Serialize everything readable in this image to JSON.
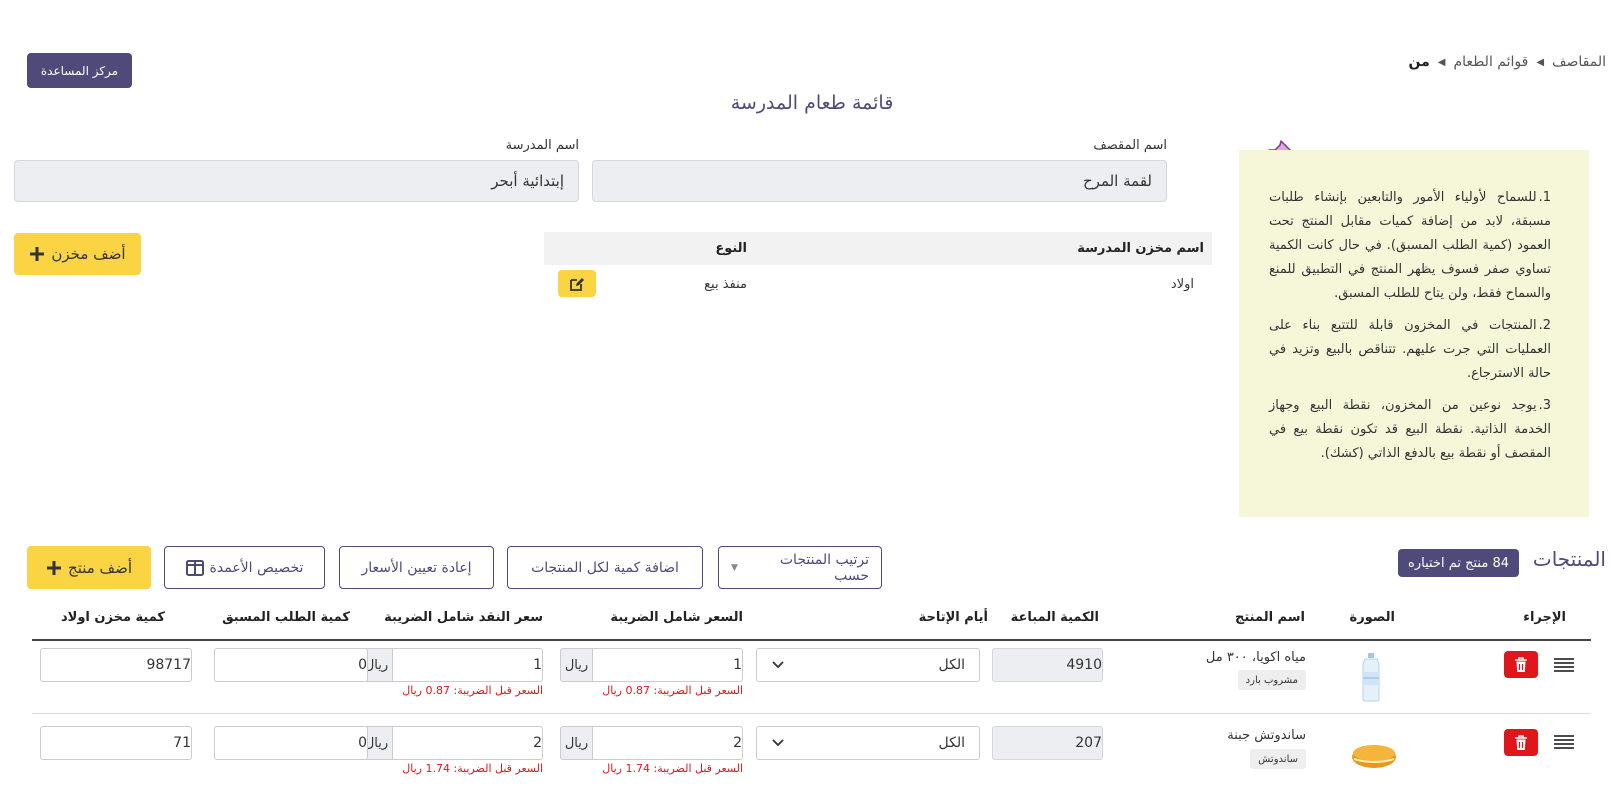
{
  "breadcrumb": {
    "items": [
      "المقاصف",
      "قوائم الطعام"
    ],
    "current": "من"
  },
  "help_button": "مركز المساعدة",
  "page_title": "قائمة طعام المدرسة",
  "notes": [
    {
      "num": "1.",
      "text": "للسماح لأولياء الأمور والتابعين بإنشاء طلبات مسبقة، لابد من إضافة كميات مقابل المنتج تحت العمود (كمية الطلب المسبق). في حال كانت الكمية تساوي صفر فسوف يظهر المنتج في التطبيق للمنع والسماح فقط، ولن يتاح للطلب المسبق."
    },
    {
      "num": "2.",
      "text": "المنتجات في المخزون قابلة للتتبع بناء على العمليات التي جرت عليهم. تتناقص بالبيع وتزيد في حالة الاسترجاع."
    },
    {
      "num": "3.",
      "text": "يوجد نوعين من المخزون، نقطة البيع وجهاز الخدمة الذاتية. نقطة البيع قد تكون نقطة بيع في المقصف أو نقطة بيع بالدفع الذاتي (كشك)."
    }
  ],
  "form": {
    "canteen_label": "اسم المقصف",
    "canteen_value": "لقمة المرح",
    "school_label": "اسم المدرسة",
    "school_value": "إبتدائية أبحر"
  },
  "warehouses": {
    "headers": {
      "name": "اسم مخزن المدرسة",
      "type": "النوع"
    },
    "rows": [
      {
        "name": "اولاد",
        "type": "منفذ بيع"
      }
    ],
    "add_label": "أضف مخزن"
  },
  "products": {
    "title": "المنتجات",
    "selected_badge": "84 منتج تم اختياره",
    "sort_label": "ترتيب المنتجات حسب",
    "add_qty_label": "اضافة كمية لكل المنتجات",
    "reset_prices_label": "إعادة تعيين الأسعار",
    "columns_label": "تخصيص الأعمدة",
    "add_label": "أضف منتج",
    "headers": {
      "action": "الإجراء",
      "image": "الصورة",
      "name": "اسم المنتج",
      "sold": "الكمية المباعة",
      "days": "أيام الإتاحة",
      "price": "السعر شامل الضريبة",
      "cash_price": "سعر النقد شامل الضريبة",
      "preorder": "كمية الطلب المسبق",
      "stock": "كمية مخزن اولاد"
    },
    "currency": "ريال",
    "rows": [
      {
        "name": "مياه اكويا، ٣٠٠ مل",
        "tag": "مشروب بارد",
        "sold": "4910",
        "days": "الكل",
        "price": "1",
        "cash_price": "1",
        "pre_tax": "السعر قبل الضريبة: 0.87 ريال",
        "preorder": "0",
        "stock": "98717"
      },
      {
        "name": "ساندوتش جبنة",
        "tag": "ساندوتش",
        "sold": "207",
        "days": "الكل",
        "price": "2",
        "cash_price": "2",
        "pre_tax": "السعر قبل الضريبة: 1.74 ريال",
        "preorder": "0",
        "stock": "71"
      }
    ]
  },
  "colors": {
    "primary": "#4f4a7a",
    "accent": "#fbd443",
    "danger": "#e0161b",
    "notes_bg": "#f6f6d8"
  }
}
